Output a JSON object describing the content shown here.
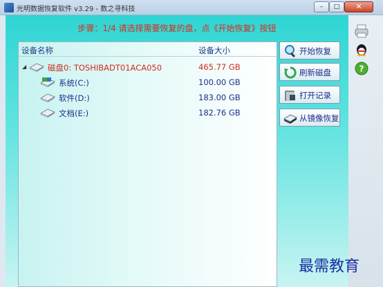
{
  "window": {
    "title": "光明数据恢复软件 v3.29 - 数之寻科技",
    "btn_min": "–",
    "btn_max": "□",
    "btn_close": "✕"
  },
  "step_text": "步骤：1/4 请选择需要恢复的盘，点《开始恢复》按钮",
  "table": {
    "col_name": "设备名称",
    "col_size": "设备大小",
    "rows": [
      {
        "name": "磁盘0: TOSHIBADT01ACA050",
        "size": "465.77 GB",
        "kind": "disk"
      },
      {
        "name": "系统(C:)",
        "size": "100.00 GB",
        "kind": "partition"
      },
      {
        "name": "软件(D:)",
        "size": "183.00 GB",
        "kind": "partition"
      },
      {
        "name": "文档(E:)",
        "size": "182.76 GB",
        "kind": "partition"
      }
    ]
  },
  "actions": {
    "start": "开始恢复",
    "refresh": "刷新磁盘",
    "open_record": "打开记录",
    "from_image": "从镜像恢复"
  },
  "side_icons": [
    "printer-icon",
    "qq-icon",
    "help-icon"
  ],
  "watermark": "最需教育",
  "colors": {
    "accent_red": "#e0281a",
    "label_blue": "#1c2f8c",
    "panel_cyan": "#2fd5d3"
  }
}
